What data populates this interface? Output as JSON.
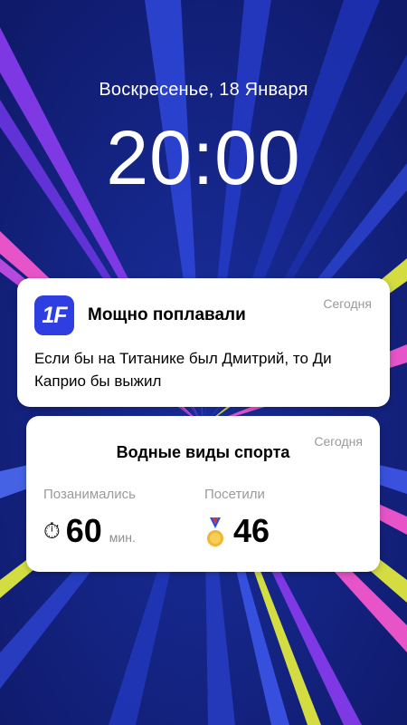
{
  "lockscreen": {
    "date": "Воскресенье, 18 Января",
    "time": "20:00"
  },
  "notification": {
    "app_icon_text": "1F",
    "app_icon_color": "#2f3ee0",
    "title": "Мощно поплавали",
    "time": "Сегодня",
    "body": "Если бы на Титанике был Дмитрий, то Ди Каприо бы выжил"
  },
  "widget": {
    "title": "Водные виды спорта",
    "time": "Сегодня",
    "stats": [
      {
        "label": "Позанимались",
        "icon": "stopwatch-icon",
        "value": "60",
        "unit": "мин."
      },
      {
        "label": "Посетили",
        "icon": "medal-icon",
        "value": "46",
        "unit": ""
      }
    ]
  },
  "colors": {
    "background": "#14217a",
    "ray_purple": "#8a3cf0",
    "ray_pink": "#ff5ad2",
    "ray_yellow": "#e8f23c",
    "ray_blue": "#3f57e8"
  }
}
